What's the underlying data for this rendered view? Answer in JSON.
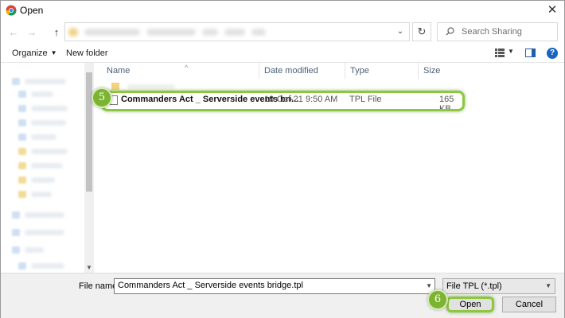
{
  "window": {
    "title": "Open",
    "close_glyph": "✕"
  },
  "nav": {
    "back_glyph": "←",
    "forward_glyph": "→",
    "up_glyph": "↑",
    "refresh_glyph": "↻",
    "dropdown_glyph": "⌄"
  },
  "search": {
    "placeholder": "Search Sharing",
    "icon": "search-icon"
  },
  "toolbar": {
    "organize_label": "Organize",
    "new_folder_label": "New folder",
    "help_glyph": "?"
  },
  "columns": {
    "name": "Name",
    "date": "Date modified",
    "type": "Type",
    "size": "Size",
    "sort_glyph": "^"
  },
  "file": {
    "name": "Commanders Act _ Serverside events bri...",
    "date": "19-Oct-21 9:50 AM",
    "type": "TPL File",
    "size": "165 KB"
  },
  "bottom": {
    "file_name_label": "File name:",
    "file_name_value": "Commanders Act _ Serverside events bridge.tpl",
    "file_type_filter": "File TPL (*.tpl)",
    "open_label": "Open",
    "cancel_label": "Cancel"
  },
  "callouts": {
    "step_5": "5",
    "step_6": "6"
  },
  "colors": {
    "highlight": "#8dc63f",
    "callout": "#7cb332",
    "accent": "#1765c0"
  }
}
